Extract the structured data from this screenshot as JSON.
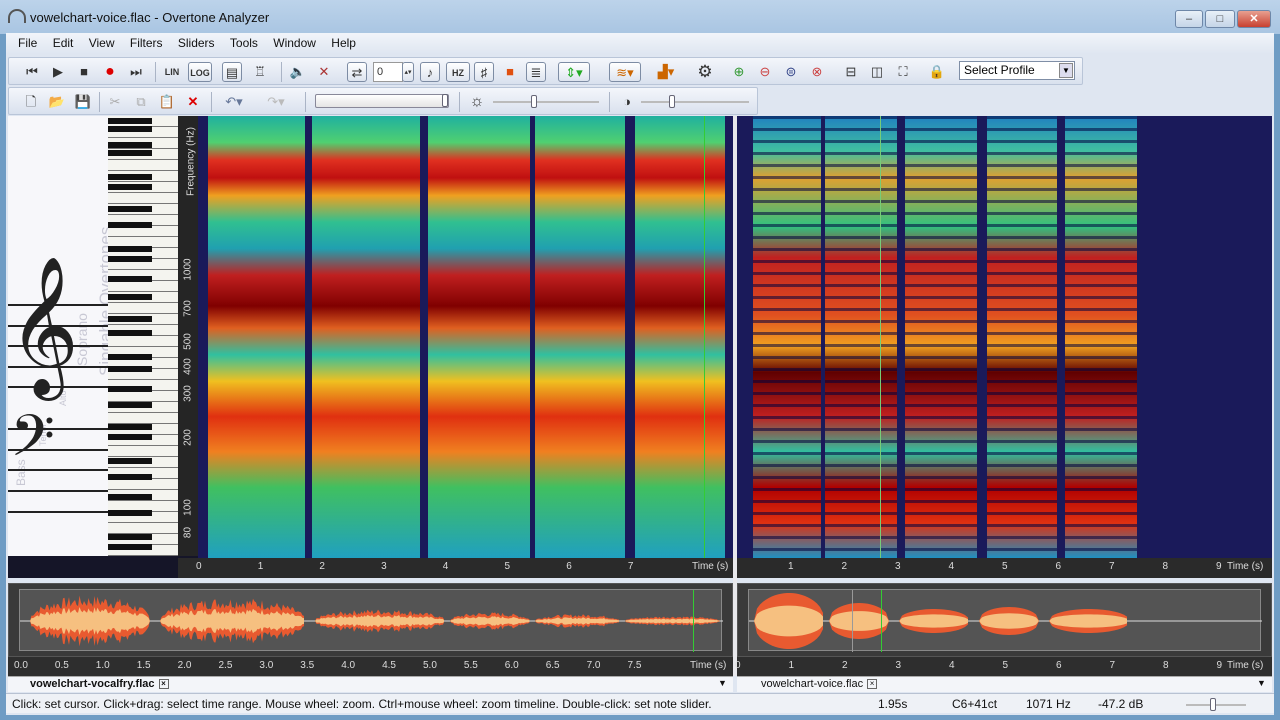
{
  "window": {
    "title": "vowelchart-voice.flac - Overtone Analyzer",
    "minimize": "–",
    "maximize": "□",
    "close": "✕"
  },
  "menu": [
    "File",
    "Edit",
    "View",
    "Filters",
    "Sliders",
    "Tools",
    "Window",
    "Help"
  ],
  "toolbar": {
    "lin_label": "LIN",
    "log_label": "LOG",
    "transpose_value": "0",
    "hz_label": "HZ",
    "profile_select": "Select Profile"
  },
  "piano_panel": {
    "watermark_lines": [
      "Singable Overtones",
      "Soprano",
      "Alto",
      "Tenor",
      "Bass"
    ]
  },
  "freq_axis": {
    "label": "Frequency (Hz)",
    "ticks": [
      "1000",
      "700",
      "500",
      "400",
      "300",
      "200",
      "100",
      "80"
    ]
  },
  "left_pane": {
    "time_ticks": [
      "0",
      "1",
      "2",
      "3",
      "4",
      "5",
      "6",
      "7"
    ],
    "time_label": "Time (s)",
    "timeline_ticks": [
      "0.0",
      "0.5",
      "1.0",
      "1.5",
      "2.0",
      "2.5",
      "3.0",
      "3.5",
      "4.0",
      "4.5",
      "5.0",
      "5.5",
      "6.0",
      "6.5",
      "7.0",
      "7.5"
    ],
    "tab": "vowelchart-vocalfry.flac"
  },
  "right_pane": {
    "time_ticks": [
      "1",
      "2",
      "3",
      "4",
      "5",
      "6",
      "7",
      "8",
      "9"
    ],
    "time_label": "Time (s)",
    "timeline_ticks": [
      "0",
      "1",
      "2",
      "3",
      "4",
      "5",
      "6",
      "7",
      "8",
      "9"
    ],
    "tab": "vowelchart-voice.flac"
  },
  "status": {
    "hint": "Click: set cursor. Click+drag: select time range. Mouse wheel: zoom. Ctrl+mouse wheel: zoom timeline. Double-click: set note slider.",
    "time": "1.95s",
    "note": "C6+41ct",
    "freq": "1071 Hz",
    "level": "-47.2 dB"
  }
}
